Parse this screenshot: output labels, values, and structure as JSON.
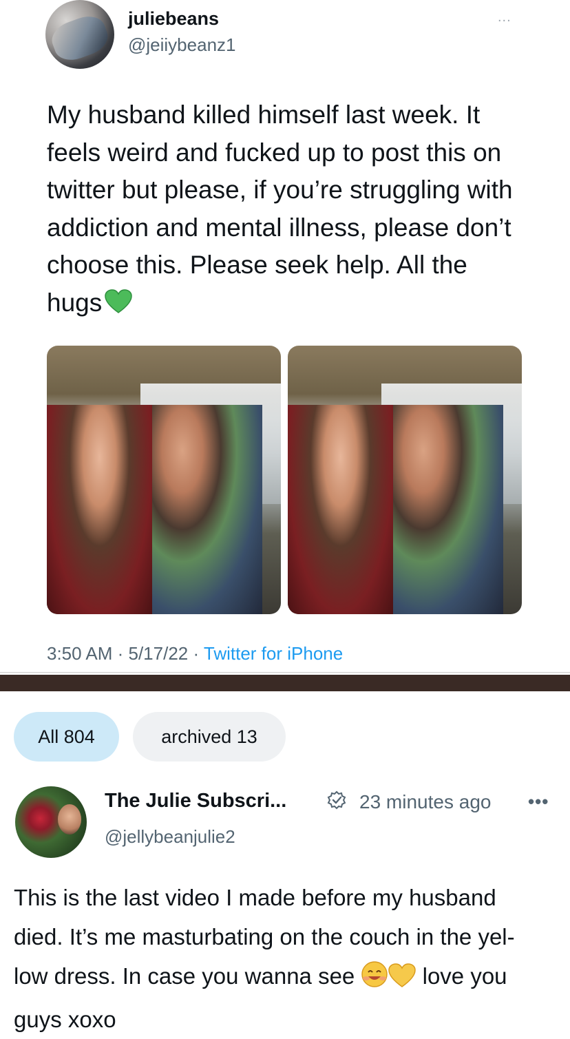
{
  "tweet": {
    "display_name": "juliebeans",
    "handle": "@jeiiybeanz1",
    "more_label": "...",
    "text": "My husband killed himself last week. It feels weird and fucked up to post this on twitter but please, if you’re struggling with addiction and mental illness, please don’t choose this. Please seek help. All the hugs",
    "emoji": "green-heart",
    "time": "3:50 AM · 5/17/22 · ",
    "source": "Twitter for iPhone",
    "photos": [
      "photo-1",
      "photo-2"
    ]
  },
  "tabs": {
    "all": "All 804",
    "archived": "archived 13"
  },
  "post": {
    "display_name": "The Julie Subscri...",
    "verified_icon": "verified-badge-icon",
    "time_ago": "23 minutes ago",
    "more_label": "•••",
    "handle": "@jellybeanjulie2",
    "text_part1": "This is the last video I made before my husband died. It’s me masturbating on the couch in the yel- low dress. In case you wanna see ",
    "text_part2": " love you guys xoxo",
    "emojis": [
      "smiling-face-icon",
      "yellow-heart-icon"
    ]
  },
  "colors": {
    "text": "#0f1419",
    "secondary": "#536471",
    "link": "#1d9bf0",
    "tab_active": "#cde9f8",
    "tab_inactive": "#eff1f3",
    "separator": "#3a2a25"
  }
}
